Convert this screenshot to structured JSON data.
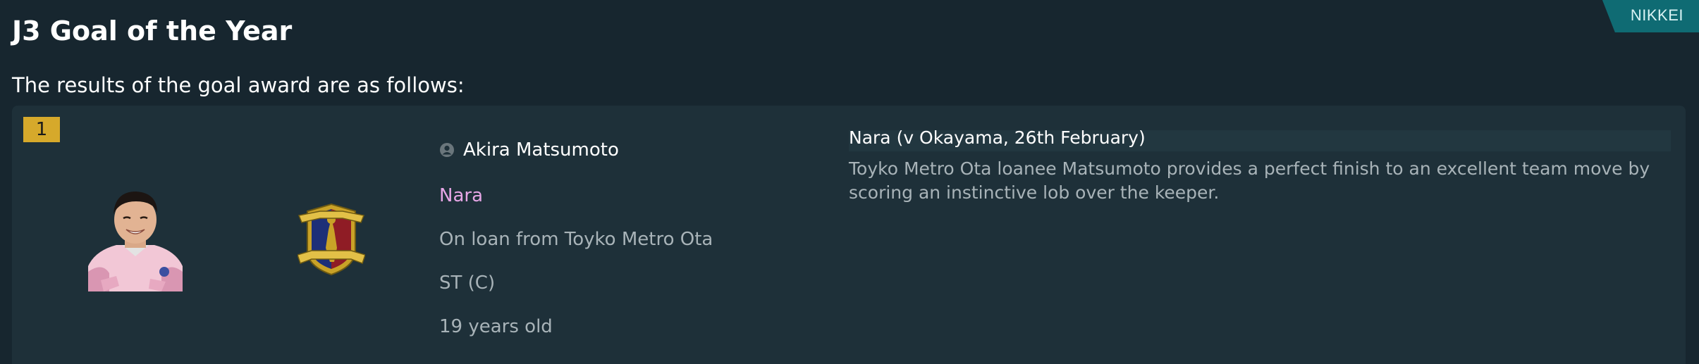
{
  "header": {
    "title": "J3 Goal of the Year",
    "source": "NIKKEI"
  },
  "subtitle": "The results of the goal award are as follows:",
  "award": {
    "rank": "1",
    "player": {
      "name": "Akira Matsumoto",
      "club": "Nara",
      "loan_status": "On loan from Toyko Metro Ota",
      "position": "ST (C)",
      "age": "19 years old"
    },
    "goal": {
      "match": "Nara (v Okayama, 26th February)",
      "description": "Toyko Metro Ota loanee Matsumoto provides a perfect finish to an excellent team move by scoring an instinctive lob over the keeper."
    }
  },
  "colors": {
    "background": "#17262f",
    "card": "#1e3039",
    "rank_badge": "#d6a92b",
    "club_name": "#e6a6e6",
    "source_badge": "#0f6b73"
  },
  "icons": {
    "player_type": "person-icon",
    "club": "club-crest",
    "player": "player-photo"
  }
}
